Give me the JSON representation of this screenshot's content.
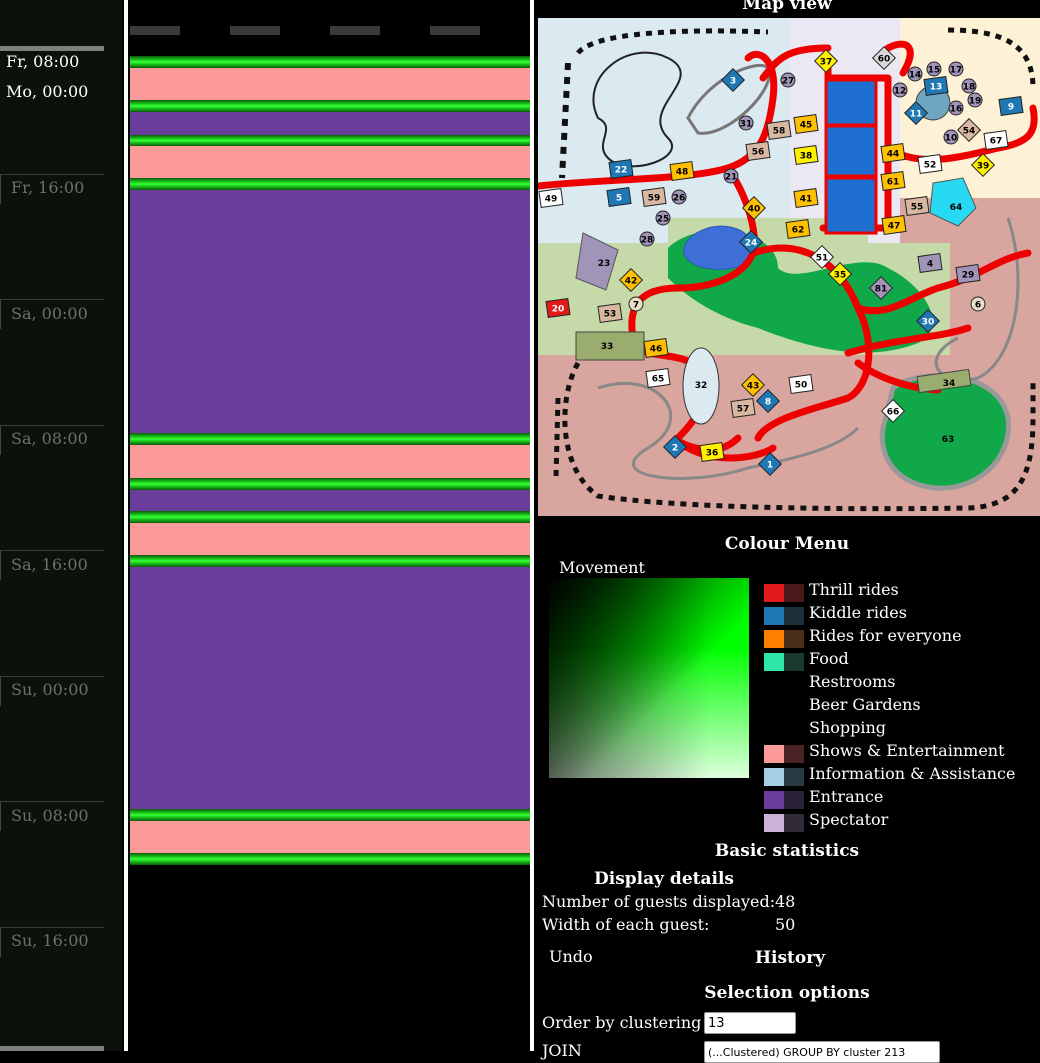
{
  "time_axis": {
    "range_start": "Fr, 08:00",
    "range_end": "Mo, 00:00",
    "ticks": [
      "Fr, 16:00",
      "Sa, 00:00",
      "Sa, 08:00",
      "Sa, 16:00",
      "Su, 00:00",
      "Su, 08:00",
      "Su, 16:00"
    ]
  },
  "map": {
    "title": "Map view",
    "labels": [
      "1",
      "2",
      "3",
      "4",
      "5",
      "6",
      "7",
      "8",
      "9",
      "10",
      "11",
      "12",
      "13",
      "14",
      "15",
      "16",
      "17",
      "18",
      "19",
      "20",
      "21",
      "22",
      "23",
      "24",
      "25",
      "26",
      "27",
      "28",
      "29",
      "30",
      "31",
      "32",
      "33",
      "34",
      "35",
      "36",
      "37",
      "38",
      "39",
      "40",
      "41",
      "42",
      "43",
      "44",
      "45",
      "46",
      "47",
      "48",
      "49",
      "50",
      "51",
      "52",
      "53",
      "54",
      "55",
      "56",
      "57",
      "58",
      "59",
      "60",
      "61",
      "62",
      "63",
      "64",
      "65",
      "66",
      "67",
      "81"
    ]
  },
  "colour_menu": {
    "title": "Colour Menu",
    "movement_label": "Movement",
    "items": [
      {
        "label": "Thrill rides",
        "color": "#e31a1c",
        "dim": "#4a1a1a"
      },
      {
        "label": "Kiddle rides",
        "color": "#1f78b4",
        "dim": "#1f2f3a"
      },
      {
        "label": "Rides for everyone",
        "color": "#ff7f00",
        "dim": "#4a2e18"
      },
      {
        "label": "Food",
        "color": "#2ee6a8",
        "dim": "#1a3a2e"
      },
      {
        "label": "Restrooms",
        "color": "",
        "dim": ""
      },
      {
        "label": "Beer Gardens",
        "color": "",
        "dim": ""
      },
      {
        "label": "Shopping",
        "color": "",
        "dim": ""
      },
      {
        "label": "Shows & Entertainment",
        "color": "#fb9a99",
        "dim": "#4a2424"
      },
      {
        "label": "Information & Assistance",
        "color": "#a6cee3",
        "dim": "#2a3a42"
      },
      {
        "label": "Entrance",
        "color": "#6a3d9a",
        "dim": "#2a2238"
      },
      {
        "label": "Spectator",
        "color": "#cab2d6",
        "dim": "#322a38"
      }
    ]
  },
  "basic_statistics": {
    "title": "Basic statistics"
  },
  "display_details": {
    "title": "Display details",
    "guests_label": "Number of guests displayed:",
    "guests_value": "48",
    "width_label": "Width of each guest:",
    "width_value": "50"
  },
  "history": {
    "undo_label": "Undo",
    "title": "History"
  },
  "selection_options": {
    "title": "Selection options",
    "order_label": "Order by clustering",
    "order_value": "13",
    "join_label": "JOIN",
    "join_value": "(...Clustered) GROUP BY cluster 213"
  },
  "timeline": {
    "color_entrance": "#6a3d9a",
    "color_shows": "#fb9a99",
    "color_movement": "#1ee51e"
  }
}
